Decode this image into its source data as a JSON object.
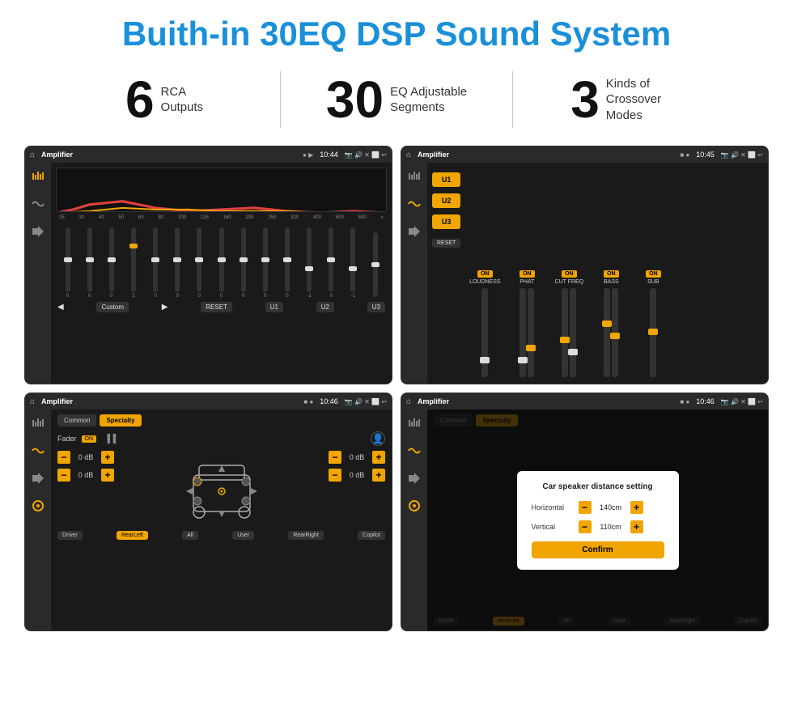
{
  "page": {
    "title": "Buith-in 30EQ DSP Sound System",
    "stats": [
      {
        "number": "6",
        "label": "RCA\nOutputs"
      },
      {
        "number": "30",
        "label": "EQ Adjustable\nSegments"
      },
      {
        "number": "3",
        "label": "Kinds of\nCrossover Modes"
      }
    ]
  },
  "screens": {
    "eq": {
      "time": "10:44",
      "title": "Amplifier",
      "bands": [
        "25",
        "32",
        "40",
        "50",
        "63",
        "80",
        "100",
        "125",
        "160",
        "200",
        "250",
        "320",
        "400",
        "500",
        "630"
      ],
      "values": [
        "0",
        "0",
        "0",
        "5",
        "0",
        "0",
        "0",
        "0",
        "0",
        "0",
        "0",
        "-1",
        "0",
        "-1",
        ""
      ],
      "sliderPositions": [
        40,
        40,
        40,
        25,
        40,
        40,
        40,
        40,
        40,
        40,
        40,
        50,
        40,
        50,
        40
      ],
      "buttons": [
        "Custom",
        "RESET",
        "U1",
        "U2",
        "U3"
      ]
    },
    "crossover": {
      "time": "10:45",
      "title": "Amplifier",
      "channels": [
        "LOUDNESS",
        "PHAT",
        "CUT FREQ",
        "BASS",
        "SUB"
      ],
      "uButtons": [
        "U1",
        "U2",
        "U3"
      ],
      "resetLabel": "RESET"
    },
    "fader": {
      "time": "10:46",
      "title": "Amplifier",
      "tabs": [
        "Common",
        "Specialty"
      ],
      "faderLabel": "Fader",
      "onLabel": "ON",
      "dbRows": [
        {
          "value": "0 dB"
        },
        {
          "value": "0 dB"
        },
        {
          "value": "0 dB"
        },
        {
          "value": "0 dB"
        }
      ],
      "bottomBtns": [
        "Driver",
        "RearLeft",
        "All",
        "User",
        "RearRight",
        "Copilot"
      ]
    },
    "faderDialog": {
      "time": "10:46",
      "title": "Amplifier",
      "tabs": [
        "Common",
        "Specialty"
      ],
      "dialogTitle": "Car speaker distance setting",
      "horizontal": {
        "label": "Horizontal",
        "value": "140cm"
      },
      "vertical": {
        "label": "Vertical",
        "value": "110cm"
      },
      "confirmLabel": "Confirm",
      "bottomBtns": [
        "Driver",
        "RearLeft",
        "All",
        "User",
        "RearRight",
        "Copilot"
      ]
    }
  }
}
